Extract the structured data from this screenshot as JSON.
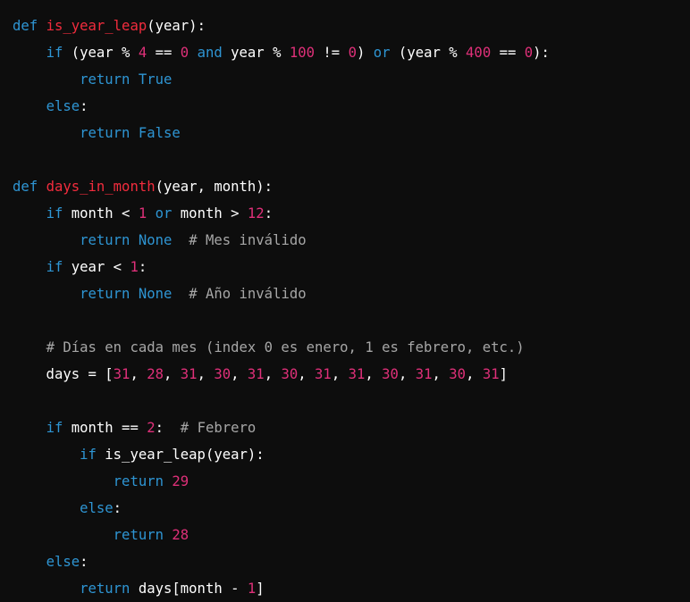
{
  "colors": {
    "background": "#0d0d0d",
    "default": "#ffffff",
    "keyword": "#2e95d3",
    "function": "#f22c3d",
    "number": "#df3079",
    "comment": "#a6a6a6"
  },
  "code": {
    "language": "python",
    "lines": [
      {
        "tokens": [
          {
            "t": "keyword",
            "v": "def"
          },
          {
            "t": "default",
            "v": " "
          },
          {
            "t": "function",
            "v": "is_year_leap"
          },
          {
            "t": "default",
            "v": "(year):"
          }
        ]
      },
      {
        "tokens": [
          {
            "t": "default",
            "v": "    "
          },
          {
            "t": "keyword",
            "v": "if"
          },
          {
            "t": "default",
            "v": " (year % "
          },
          {
            "t": "number",
            "v": "4"
          },
          {
            "t": "default",
            "v": " == "
          },
          {
            "t": "number",
            "v": "0"
          },
          {
            "t": "default",
            "v": " "
          },
          {
            "t": "keyword",
            "v": "and"
          },
          {
            "t": "default",
            "v": " year % "
          },
          {
            "t": "number",
            "v": "100"
          },
          {
            "t": "default",
            "v": " != "
          },
          {
            "t": "number",
            "v": "0"
          },
          {
            "t": "default",
            "v": ") "
          },
          {
            "t": "keyword",
            "v": "or"
          },
          {
            "t": "default",
            "v": " (year % "
          },
          {
            "t": "number",
            "v": "400"
          },
          {
            "t": "default",
            "v": " == "
          },
          {
            "t": "number",
            "v": "0"
          },
          {
            "t": "default",
            "v": "):"
          }
        ]
      },
      {
        "tokens": [
          {
            "t": "default",
            "v": "        "
          },
          {
            "t": "keyword",
            "v": "return"
          },
          {
            "t": "default",
            "v": " "
          },
          {
            "t": "keyword",
            "v": "True"
          }
        ]
      },
      {
        "tokens": [
          {
            "t": "default",
            "v": "    "
          },
          {
            "t": "keyword",
            "v": "else"
          },
          {
            "t": "default",
            "v": ":"
          }
        ]
      },
      {
        "tokens": [
          {
            "t": "default",
            "v": "        "
          },
          {
            "t": "keyword",
            "v": "return"
          },
          {
            "t": "default",
            "v": " "
          },
          {
            "t": "keyword",
            "v": "False"
          }
        ]
      },
      {
        "tokens": []
      },
      {
        "tokens": [
          {
            "t": "keyword",
            "v": "def"
          },
          {
            "t": "default",
            "v": " "
          },
          {
            "t": "function",
            "v": "days_in_month"
          },
          {
            "t": "default",
            "v": "(year, month):"
          }
        ]
      },
      {
        "tokens": [
          {
            "t": "default",
            "v": "    "
          },
          {
            "t": "keyword",
            "v": "if"
          },
          {
            "t": "default",
            "v": " month < "
          },
          {
            "t": "number",
            "v": "1"
          },
          {
            "t": "default",
            "v": " "
          },
          {
            "t": "keyword",
            "v": "or"
          },
          {
            "t": "default",
            "v": " month > "
          },
          {
            "t": "number",
            "v": "12"
          },
          {
            "t": "default",
            "v": ":"
          }
        ]
      },
      {
        "tokens": [
          {
            "t": "default",
            "v": "        "
          },
          {
            "t": "keyword",
            "v": "return"
          },
          {
            "t": "default",
            "v": " "
          },
          {
            "t": "keyword",
            "v": "None"
          },
          {
            "t": "default",
            "v": "  "
          },
          {
            "t": "comment",
            "v": "# Mes inválido"
          }
        ]
      },
      {
        "tokens": [
          {
            "t": "default",
            "v": "    "
          },
          {
            "t": "keyword",
            "v": "if"
          },
          {
            "t": "default",
            "v": " year < "
          },
          {
            "t": "number",
            "v": "1"
          },
          {
            "t": "default",
            "v": ":"
          }
        ]
      },
      {
        "tokens": [
          {
            "t": "default",
            "v": "        "
          },
          {
            "t": "keyword",
            "v": "return"
          },
          {
            "t": "default",
            "v": " "
          },
          {
            "t": "keyword",
            "v": "None"
          },
          {
            "t": "default",
            "v": "  "
          },
          {
            "t": "comment",
            "v": "# Año inválido"
          }
        ]
      },
      {
        "tokens": []
      },
      {
        "tokens": [
          {
            "t": "default",
            "v": "    "
          },
          {
            "t": "comment",
            "v": "# Días en cada mes (index 0 es enero, 1 es febrero, etc.)"
          }
        ]
      },
      {
        "tokens": [
          {
            "t": "default",
            "v": "    days = ["
          },
          {
            "t": "number",
            "v": "31"
          },
          {
            "t": "default",
            "v": ", "
          },
          {
            "t": "number",
            "v": "28"
          },
          {
            "t": "default",
            "v": ", "
          },
          {
            "t": "number",
            "v": "31"
          },
          {
            "t": "default",
            "v": ", "
          },
          {
            "t": "number",
            "v": "30"
          },
          {
            "t": "default",
            "v": ", "
          },
          {
            "t": "number",
            "v": "31"
          },
          {
            "t": "default",
            "v": ", "
          },
          {
            "t": "number",
            "v": "30"
          },
          {
            "t": "default",
            "v": ", "
          },
          {
            "t": "number",
            "v": "31"
          },
          {
            "t": "default",
            "v": ", "
          },
          {
            "t": "number",
            "v": "31"
          },
          {
            "t": "default",
            "v": ", "
          },
          {
            "t": "number",
            "v": "30"
          },
          {
            "t": "default",
            "v": ", "
          },
          {
            "t": "number",
            "v": "31"
          },
          {
            "t": "default",
            "v": ", "
          },
          {
            "t": "number",
            "v": "30"
          },
          {
            "t": "default",
            "v": ", "
          },
          {
            "t": "number",
            "v": "31"
          },
          {
            "t": "default",
            "v": "]"
          }
        ]
      },
      {
        "tokens": []
      },
      {
        "tokens": [
          {
            "t": "default",
            "v": "    "
          },
          {
            "t": "keyword",
            "v": "if"
          },
          {
            "t": "default",
            "v": " month == "
          },
          {
            "t": "number",
            "v": "2"
          },
          {
            "t": "default",
            "v": ":  "
          },
          {
            "t": "comment",
            "v": "# Febrero"
          }
        ]
      },
      {
        "tokens": [
          {
            "t": "default",
            "v": "        "
          },
          {
            "t": "keyword",
            "v": "if"
          },
          {
            "t": "default",
            "v": " is_year_leap(year):"
          }
        ]
      },
      {
        "tokens": [
          {
            "t": "default",
            "v": "            "
          },
          {
            "t": "keyword",
            "v": "return"
          },
          {
            "t": "default",
            "v": " "
          },
          {
            "t": "number",
            "v": "29"
          }
        ]
      },
      {
        "tokens": [
          {
            "t": "default",
            "v": "        "
          },
          {
            "t": "keyword",
            "v": "else"
          },
          {
            "t": "default",
            "v": ":"
          }
        ]
      },
      {
        "tokens": [
          {
            "t": "default",
            "v": "            "
          },
          {
            "t": "keyword",
            "v": "return"
          },
          {
            "t": "default",
            "v": " "
          },
          {
            "t": "number",
            "v": "28"
          }
        ]
      },
      {
        "tokens": [
          {
            "t": "default",
            "v": "    "
          },
          {
            "t": "keyword",
            "v": "else"
          },
          {
            "t": "default",
            "v": ":"
          }
        ]
      },
      {
        "tokens": [
          {
            "t": "default",
            "v": "        "
          },
          {
            "t": "keyword",
            "v": "return"
          },
          {
            "t": "default",
            "v": " days[month - "
          },
          {
            "t": "number",
            "v": "1"
          },
          {
            "t": "default",
            "v": "]"
          }
        ]
      }
    ]
  }
}
